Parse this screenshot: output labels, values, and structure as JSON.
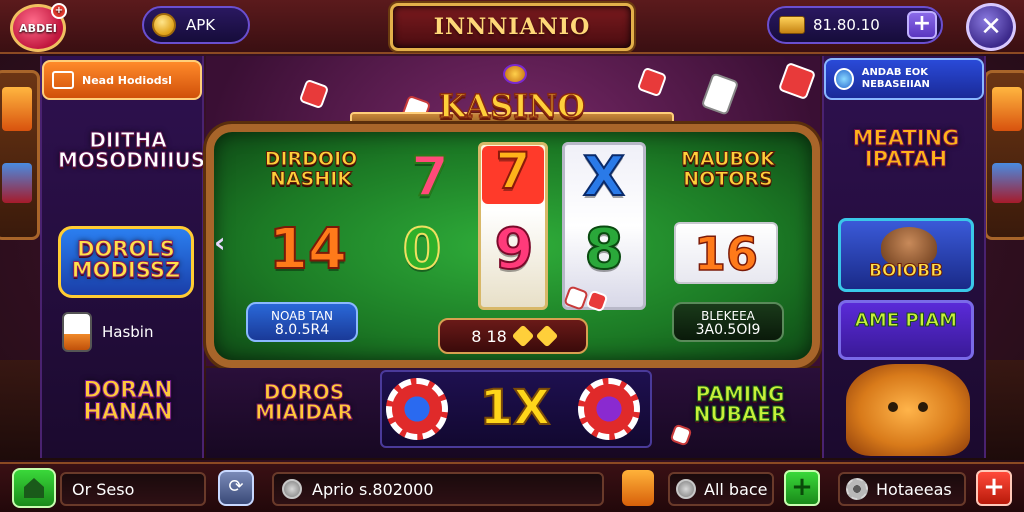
{
  "topbar": {
    "profile_label": "ABDEI",
    "apk_label": "APK",
    "title": "INNNIANIO",
    "balance": "81.80.10",
    "plus_symbol": "+",
    "close_symbol": "✕"
  },
  "left": {
    "news_label": "Nead Hodiodsl",
    "logo_a": "DIITHA MOSODNIIUS",
    "logo_b": "DOROLS MODISSZ",
    "hasbin_label": "Hasbin",
    "logo_c": "DORAN HANAN"
  },
  "center": {
    "kasino": "KASINO",
    "label_left": "DIRDOIO NASHIK",
    "label_right": "MAUBOK NOTORS",
    "reel_top": [
      "7",
      "7",
      "X"
    ],
    "reel_bottom": [
      "14",
      "0",
      "9",
      "8"
    ],
    "tile_16": "16",
    "info_left_top": "NOAB TAN",
    "info_left_bottom": "8.0.5R4",
    "info_right_top": "BLEKEEA",
    "info_right_bottom": "3A0.5OI9",
    "bet_label": "8 18",
    "logo_d": "DOROS MIAIDAR",
    "multiplier": "1X",
    "logo_e": "PAMING NUBAER",
    "arrow_left": "‹",
    "arrow_right": "›"
  },
  "right": {
    "news_label": "ANDAB EOK NEBASEIIAN",
    "logo_f": "MEATING IPATAH",
    "card_a": "BOIOBB",
    "card_b": "AME PIAM"
  },
  "bottombar": {
    "field_a": "Or Seso",
    "refresh_symbol": "⟳",
    "field_b": "Aprio s.802000",
    "field_c": "All bace",
    "green_plus": "+",
    "field_d": "Hotaeeas",
    "red_plus": "+"
  },
  "colors": {
    "accent_gold": "#ffcf3a",
    "table_green": "#2fae3a",
    "frame_wood": "#a8652a",
    "panel_purple": "#2f1150"
  },
  "icons": {
    "coin": "coin-icon",
    "gold_bars": "gold-bars-icon",
    "news": "newspaper-icon",
    "dice": "dice-icon",
    "tag": "tag-icon",
    "home": "home-icon",
    "refresh": "refresh-icon",
    "bag": "shopping-bag-icon",
    "gear": "gear-icon"
  }
}
